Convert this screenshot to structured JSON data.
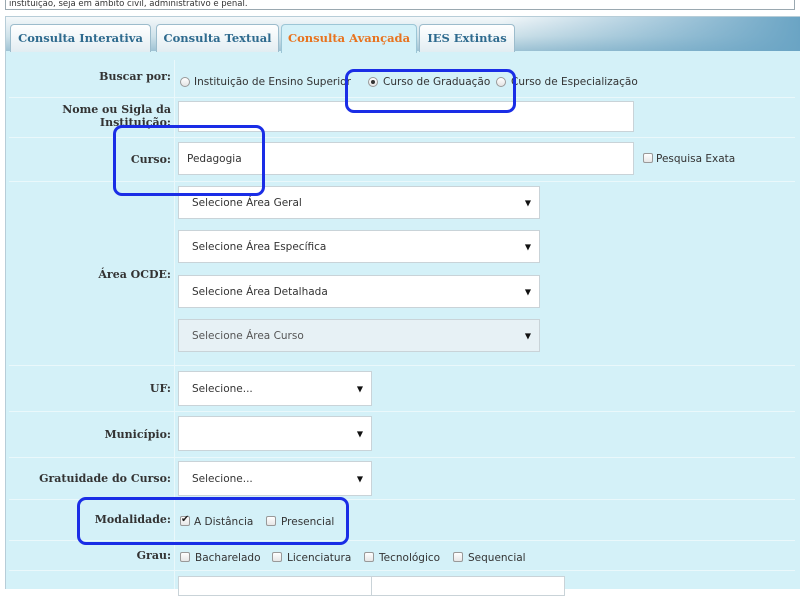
{
  "notice": {
    "text": "instituição, seja em âmbito civil, administrativo e penal."
  },
  "tabs": [
    {
      "label": "Consulta Interativa"
    },
    {
      "label": "Consulta Textual"
    },
    {
      "label": "Consulta Avançada",
      "active": true
    },
    {
      "label": "IES Extintas"
    }
  ],
  "form": {
    "buscar_por": {
      "label": "Buscar por:",
      "options": [
        "Instituição de Ensino Superior",
        "Curso de Graduação",
        "Curso de Especialização"
      ],
      "selected": "Curso de Graduação"
    },
    "instituicao": {
      "label": "Nome ou Sigla da Instituição:",
      "value": ""
    },
    "curso": {
      "label": "Curso:",
      "value": "Pedagogia",
      "exact_label": "Pesquisa Exata",
      "exact_checked": false
    },
    "area_ocde": {
      "label": "Área OCDE:",
      "selects": [
        "Selecione Área Geral",
        "Selecione Área Específica",
        "Selecione Área Detalhada",
        "Selecione Área Curso"
      ]
    },
    "uf": {
      "label": "UF:",
      "value": "Selecione..."
    },
    "municipio": {
      "label": "Município:",
      "value": ""
    },
    "gratuidade": {
      "label": "Gratuidade do Curso:",
      "value": "Selecione..."
    },
    "modalidade": {
      "label": "Modalidade:",
      "options": [
        {
          "label": "A Distância",
          "checked": true
        },
        {
          "label": "Presencial",
          "checked": false
        }
      ]
    },
    "grau": {
      "label": "Grau:",
      "options": [
        "Bacharelado",
        "Licenciatura",
        "Tecnológico",
        "Sequencial"
      ]
    }
  },
  "colors": {
    "panel_bg": "#d4f1f8",
    "tab_active_text": "#e8731f",
    "tab_text": "#2e6a8e",
    "highlight": "#1a2de6"
  },
  "icons": {
    "select_arrow": "triangle-down-icon"
  }
}
